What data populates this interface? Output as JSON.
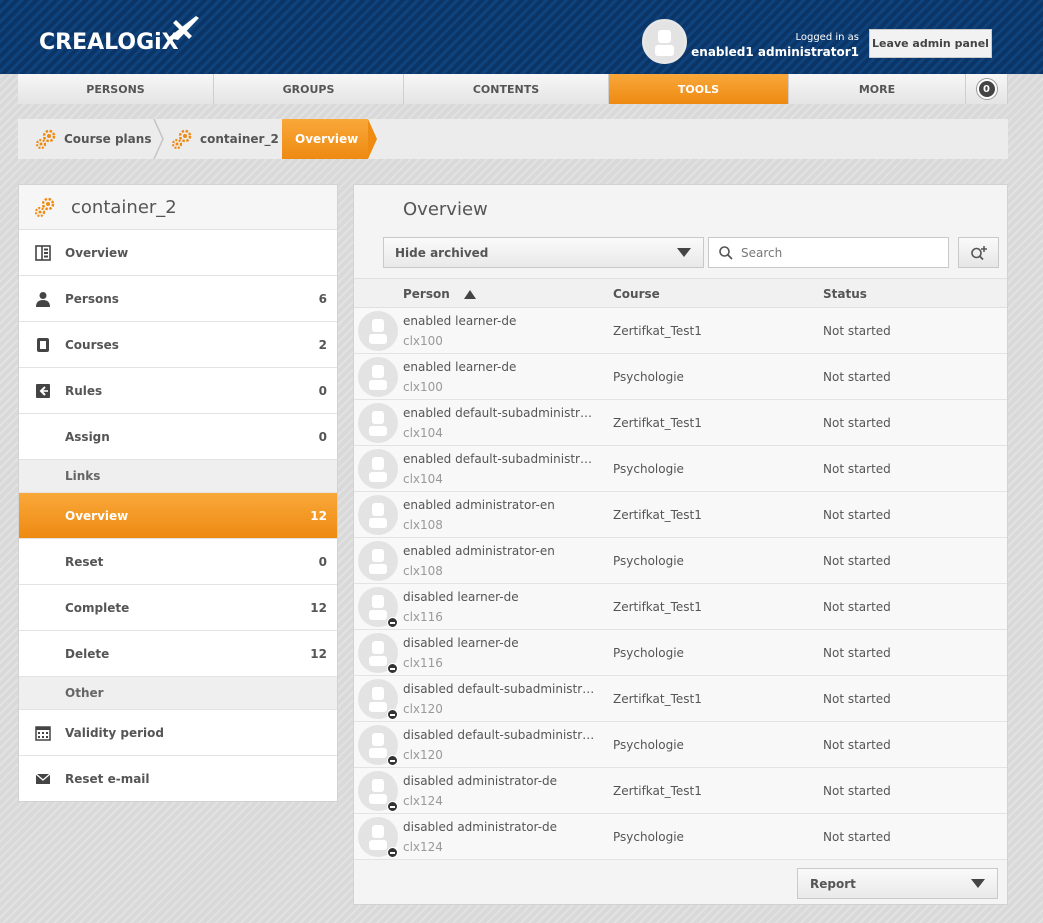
{
  "header": {
    "logo_text": "CREALOGiX",
    "logged_in_label": "Logged in as",
    "user_name": "enabled1 administrator1",
    "leave_button": "Leave admin panel"
  },
  "nav": {
    "tabs": [
      {
        "label": "PERSONS"
      },
      {
        "label": "GROUPS"
      },
      {
        "label": "CONTENTS"
      },
      {
        "label": "TOOLS"
      },
      {
        "label": "MORE"
      }
    ],
    "badge_count": "0"
  },
  "breadcrumb": {
    "items": [
      "Course plans",
      "container_2"
    ],
    "active": "Overview"
  },
  "sidebar": {
    "title": "container_2",
    "items": [
      {
        "label": "Overview",
        "count": "",
        "icon": "overview-icon"
      },
      {
        "label": "Persons",
        "count": "6",
        "icon": "person-icon"
      },
      {
        "label": "Courses",
        "count": "2",
        "icon": "course-icon"
      },
      {
        "label": "Rules",
        "count": "0",
        "icon": "rules-icon"
      },
      {
        "label": "Assign",
        "count": "0"
      }
    ],
    "links_section": "Links",
    "link_items": [
      {
        "label": "Overview",
        "count": "12"
      },
      {
        "label": "Reset",
        "count": "0"
      },
      {
        "label": "Complete",
        "count": "12"
      },
      {
        "label": "Delete",
        "count": "12"
      }
    ],
    "other_section": "Other",
    "other_items": [
      {
        "label": "Validity period",
        "icon": "calendar-icon"
      },
      {
        "label": "Reset e-mail",
        "icon": "envelope-icon"
      }
    ]
  },
  "main": {
    "title": "Overview",
    "filter_value": "Hide archived",
    "search_placeholder": "Search",
    "columns": {
      "person": "Person",
      "course": "Course",
      "status": "Status"
    },
    "rows": [
      {
        "name": "enabled learner-de",
        "id": "clx100",
        "course": "Zertifkat_Test1",
        "status": "Not started",
        "disabled": false
      },
      {
        "name": "enabled learner-de",
        "id": "clx100",
        "course": "Psychologie",
        "status": "Not started",
        "disabled": false
      },
      {
        "name": "enabled default-subadministrat...",
        "id": "clx104",
        "course": "Zertifkat_Test1",
        "status": "Not started",
        "disabled": false
      },
      {
        "name": "enabled default-subadministrat...",
        "id": "clx104",
        "course": "Psychologie",
        "status": "Not started",
        "disabled": false
      },
      {
        "name": "enabled administrator-en",
        "id": "clx108",
        "course": "Zertifkat_Test1",
        "status": "Not started",
        "disabled": false
      },
      {
        "name": "enabled administrator-en",
        "id": "clx108",
        "course": "Psychologie",
        "status": "Not started",
        "disabled": false
      },
      {
        "name": "disabled learner-de",
        "id": "clx116",
        "course": "Zertifkat_Test1",
        "status": "Not started",
        "disabled": true
      },
      {
        "name": "disabled learner-de",
        "id": "clx116",
        "course": "Psychologie",
        "status": "Not started",
        "disabled": true
      },
      {
        "name": "disabled default-subadministrat...",
        "id": "clx120",
        "course": "Zertifkat_Test1",
        "status": "Not started",
        "disabled": true
      },
      {
        "name": "disabled default-subadministrat...",
        "id": "clx120",
        "course": "Psychologie",
        "status": "Not started",
        "disabled": true
      },
      {
        "name": "disabled administrator-de",
        "id": "clx124",
        "course": "Zertifkat_Test1",
        "status": "Not started",
        "disabled": true
      },
      {
        "name": "disabled administrator-de",
        "id": "clx124",
        "course": "Psychologie",
        "status": "Not started",
        "disabled": true
      }
    ],
    "report_label": "Report"
  },
  "colors": {
    "header_blue": "#0d3a6e",
    "accent_orange": "#f39c1f"
  }
}
